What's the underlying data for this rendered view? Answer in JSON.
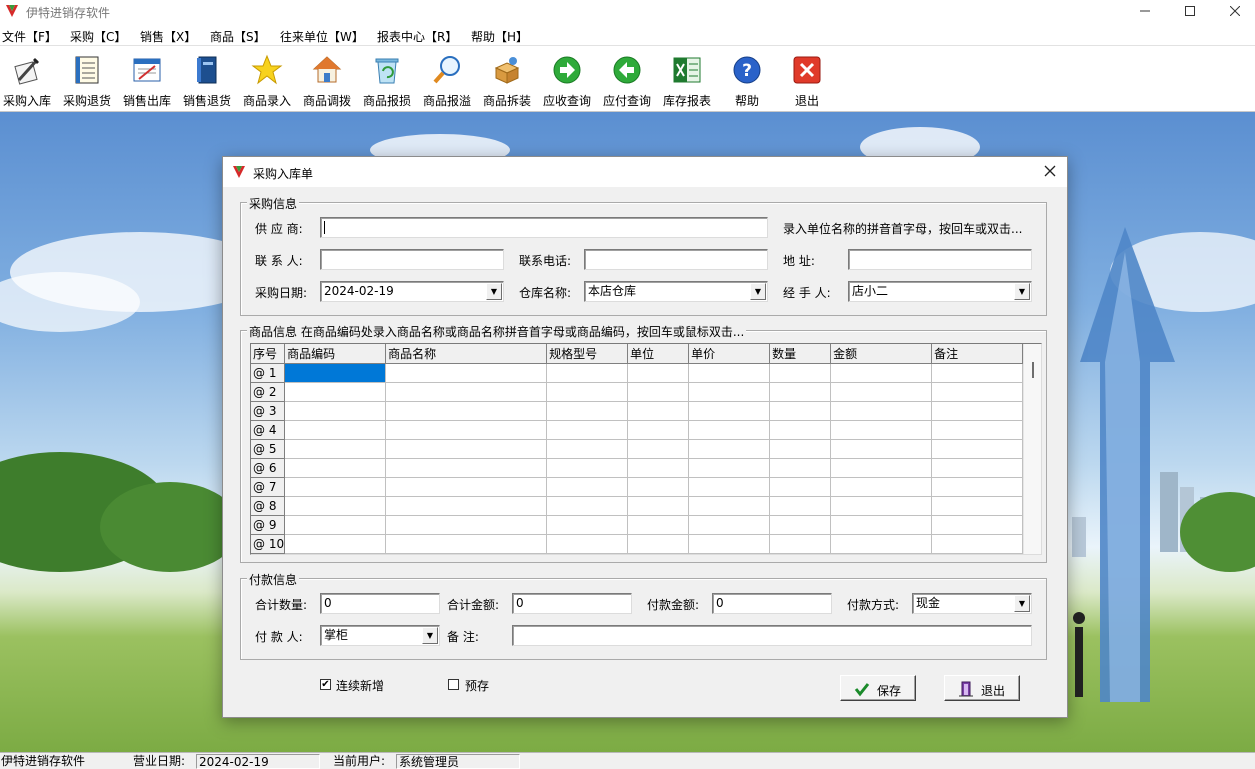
{
  "app": {
    "title": "伊特进销存软件"
  },
  "menu": [
    "文件【F】",
    "采购【C】",
    "销售【X】",
    "商品【S】",
    "往来单位【W】",
    "报表中心【R】",
    "帮助【H】"
  ],
  "toolbar": [
    {
      "label": "采购入库",
      "icon": "pen-document-icon"
    },
    {
      "label": "采购退货",
      "icon": "document-list-icon"
    },
    {
      "label": "销售出库",
      "icon": "form-icon"
    },
    {
      "label": "销售退货",
      "icon": "book-icon"
    },
    {
      "label": "商品录入",
      "icon": "star-icon"
    },
    {
      "label": "商品调拨",
      "icon": "house-icon"
    },
    {
      "label": "商品报损",
      "icon": "recycle-bin-icon"
    },
    {
      "label": "商品报溢",
      "icon": "magnifier-icon"
    },
    {
      "label": "商品拆装",
      "icon": "package-icon"
    },
    {
      "label": "应收查询",
      "icon": "arrow-right-icon"
    },
    {
      "label": "应付查询",
      "icon": "arrow-left-icon"
    },
    {
      "label": "库存报表",
      "icon": "excel-icon"
    },
    {
      "label": "帮助",
      "icon": "help-icon"
    },
    {
      "label": "退出",
      "icon": "close-icon"
    }
  ],
  "dialog": {
    "title": "采购入库单",
    "purchase": {
      "group_title": "采购信息",
      "supplier_label": "供 应 商:",
      "supplier_value": "",
      "supplier_hint": "录入单位名称的拼音首字母，按回车或双击...",
      "contact_label": "联 系 人:",
      "contact_value": "",
      "phone_label": "联系电话:",
      "phone_value": "",
      "address_label": "地    址:",
      "address_value": "",
      "date_label": "采购日期:",
      "date_value": "2024-02-19",
      "warehouse_label": "仓库名称:",
      "warehouse_value": "本店仓库",
      "handler_label": "经 手 人:",
      "handler_value": "店小二"
    },
    "goods": {
      "group_title": "商品信息 在商品编码处录入商品名称或商品名称拼音首字母或商品编码，按回车或鼠标双击...",
      "columns": [
        "序号",
        "商品编码",
        "商品名称",
        "规格型号",
        "单位",
        "单价",
        "数量",
        "金额",
        "备注"
      ],
      "rows": [
        "@ 1",
        "@ 2",
        "@ 3",
        "@ 4",
        "@ 5",
        "@ 6",
        "@ 7",
        "@ 8",
        "@ 9",
        "@ 10"
      ]
    },
    "payment": {
      "group_title": "付款信息",
      "total_qty_label": "合计数量:",
      "total_qty_value": "0",
      "total_amount_label": "合计金额:",
      "total_amount_value": "0",
      "paid_amount_label": "付款金额:",
      "paid_amount_value": "0",
      "method_label": "付款方式:",
      "method_value": "现金",
      "payer_label": "付 款 人:",
      "payer_value": "掌柜",
      "remark_label": "备    注:",
      "remark_value": ""
    },
    "continuous_label": "连续新增",
    "continuous_checked": true,
    "prestore_label": "预存",
    "prestore_checked": false,
    "save_label": "保存",
    "exit_label": "退出"
  },
  "status": {
    "app_name": "伊特进销存软件",
    "date_label": "营业日期:",
    "date_value": "2024-02-19",
    "user_label": "当前用户:",
    "user_value": "系统管理员"
  }
}
